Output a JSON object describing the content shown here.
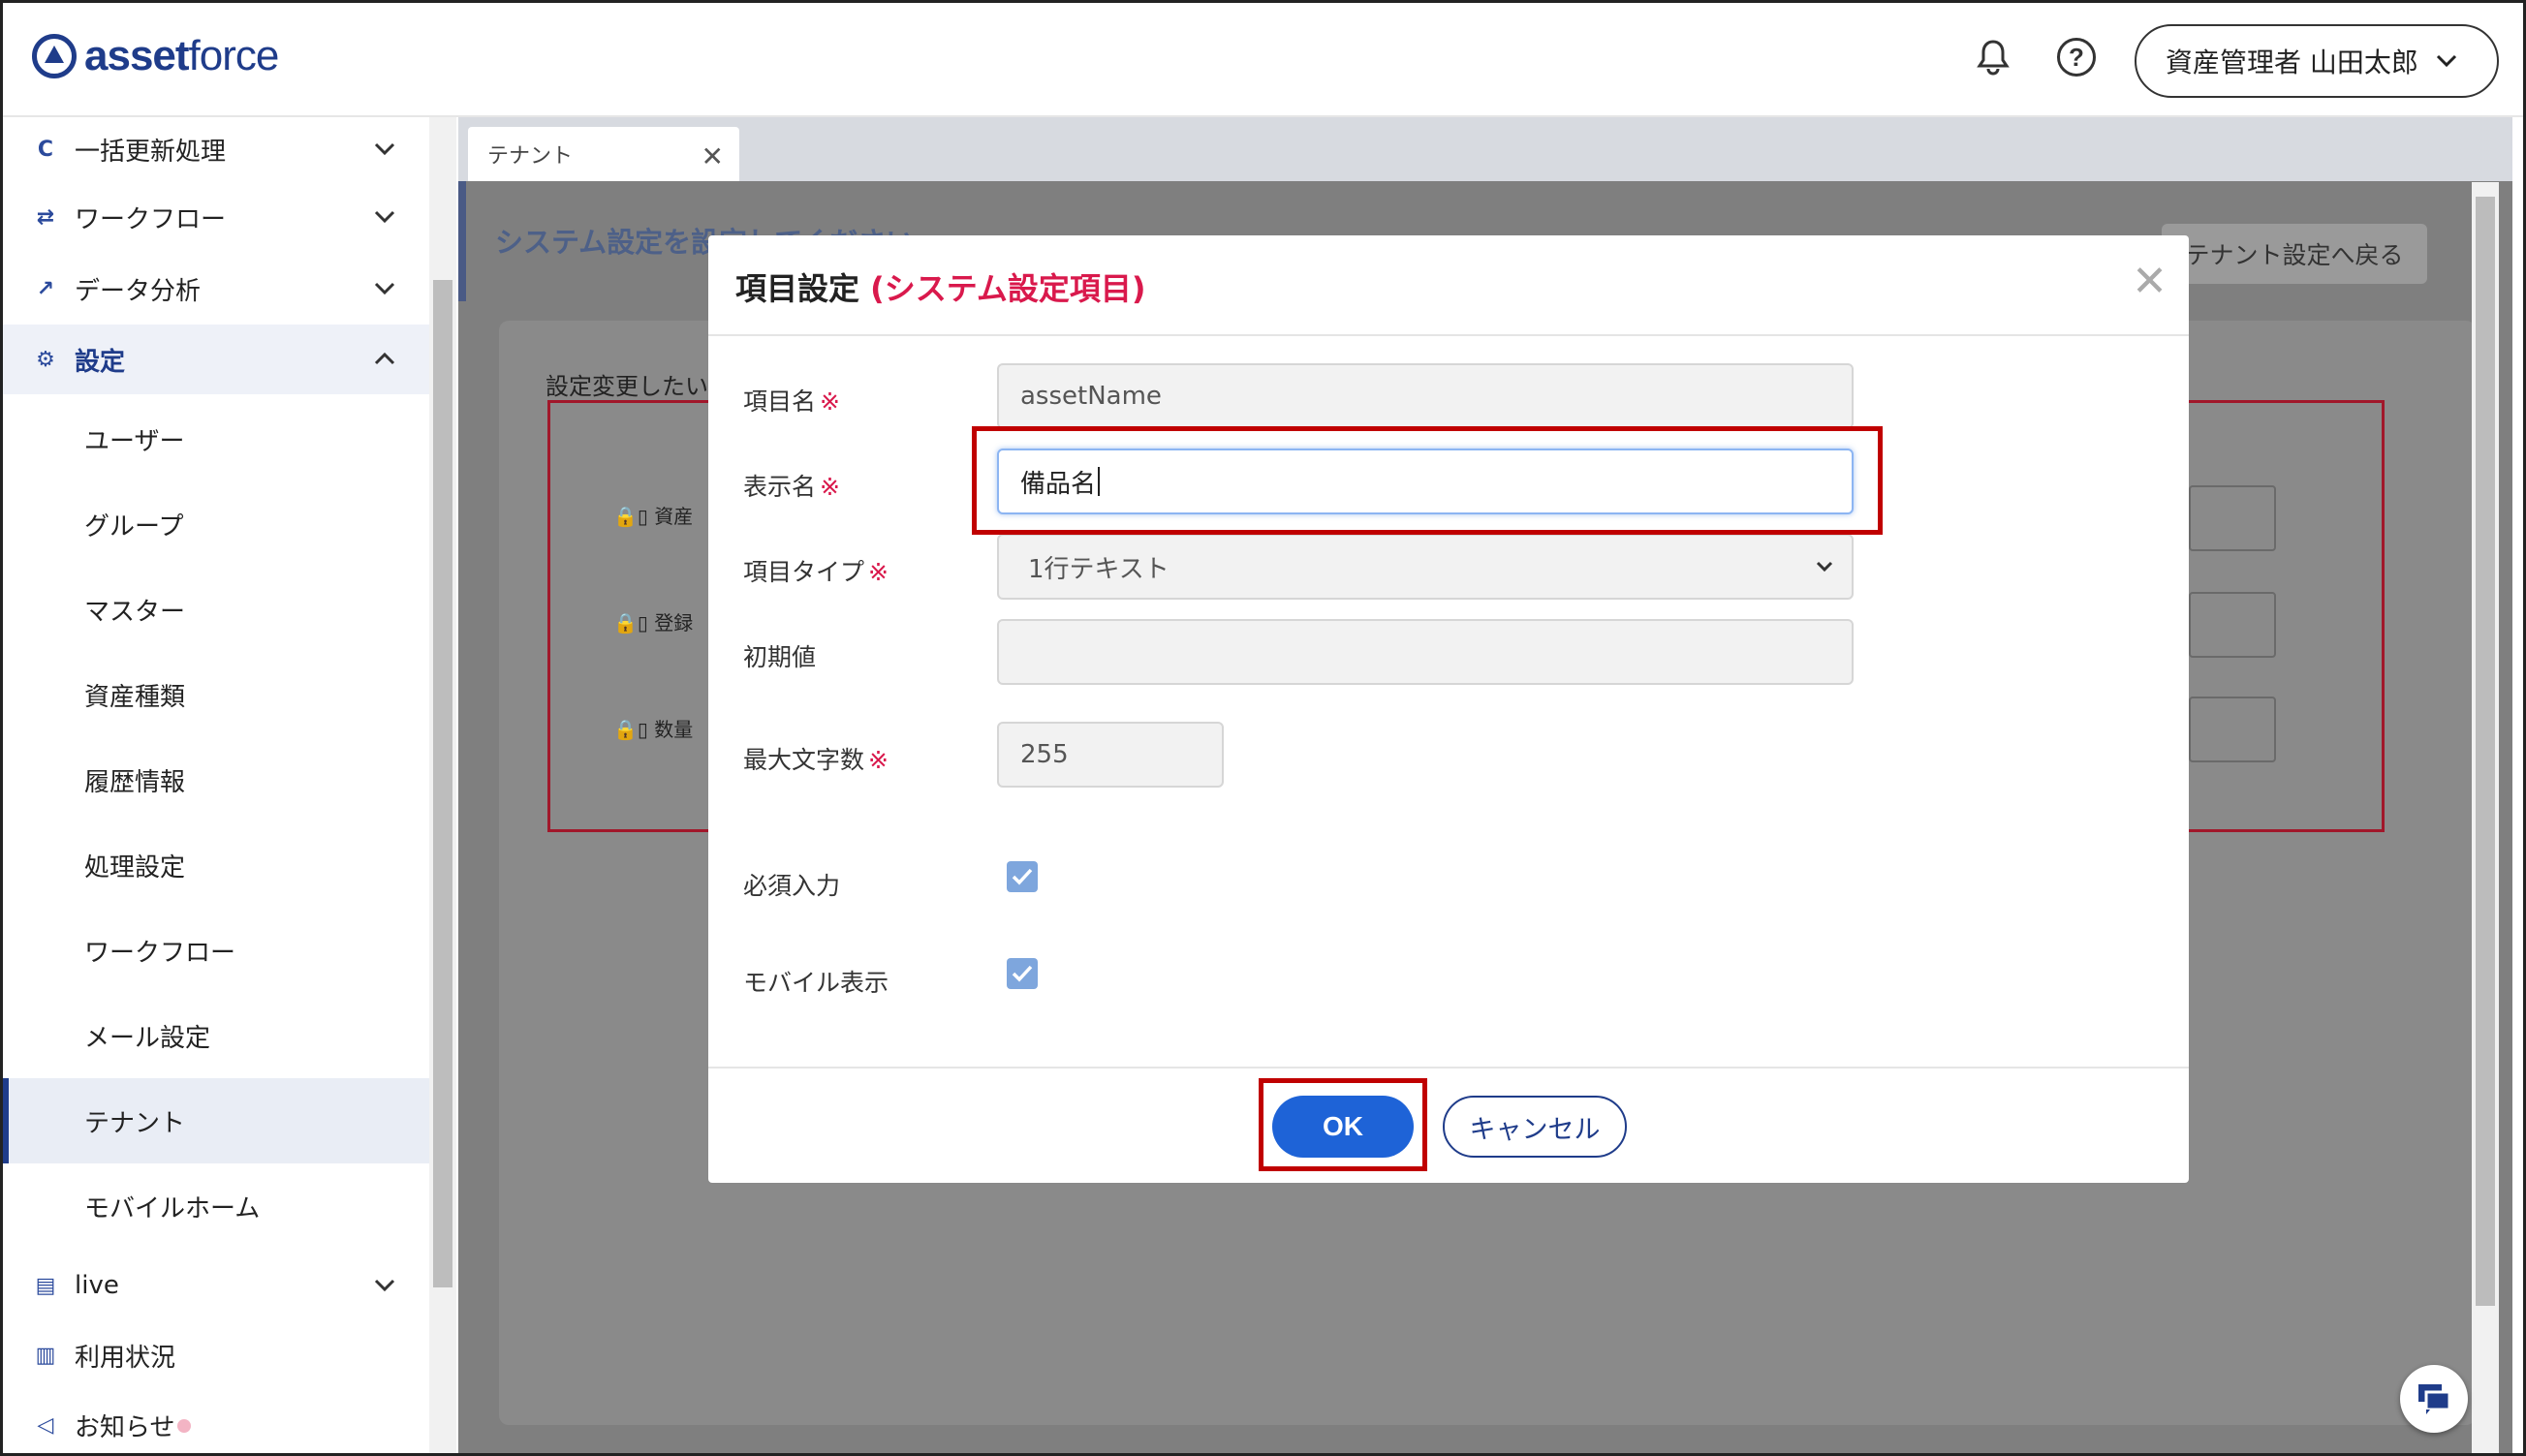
{
  "brand": {
    "bold": "asset",
    "light": "force"
  },
  "header": {
    "user_name": "資産管理者 山田太郎",
    "icons": {
      "notification": "bell-icon",
      "help": "help-circle-icon"
    }
  },
  "sidebar": {
    "groups_top": [
      {
        "label": "一括更新処理",
        "icon": "refresh-icon"
      },
      {
        "label": "ワークフロー",
        "icon": "workflow-icon"
      },
      {
        "label": "データ分析",
        "icon": "analytics-icon"
      }
    ],
    "settings": {
      "label": "設定",
      "icon": "gear-icon"
    },
    "settings_items": [
      "ユーザー",
      "グループ",
      "マスター",
      "資産種類",
      "履歴情報",
      "処理設定",
      "ワークフロー",
      "メール設定",
      "テナント",
      "モバイルホーム"
    ],
    "selected_item": "テナント",
    "groups_bottom": [
      {
        "label": "live",
        "icon": "chat-icon"
      },
      {
        "label": "利用状況",
        "icon": "bar-chart-icon"
      },
      {
        "label": "お知らせ",
        "icon": "megaphone-icon"
      }
    ]
  },
  "main": {
    "tab_label": "テナント",
    "bg_heading": "システム設定を設定してください",
    "bg_back_button": "テナント設定へ戻る",
    "bg_description": "設定変更したい",
    "bg_rows": [
      "資産",
      "登録",
      "数量"
    ]
  },
  "modal": {
    "title": "項目設定",
    "title_sub": "(システム設定項目)",
    "required_mark": "※",
    "fields": {
      "item_name": {
        "label": "項目名",
        "value": "assetName"
      },
      "display_name": {
        "label": "表示名",
        "value": "備品名"
      },
      "item_type": {
        "label": "項目タイプ",
        "value": "1行テキスト"
      },
      "initial_value": {
        "label": "初期値",
        "value": ""
      },
      "max_length": {
        "label": "最大文字数",
        "value": "255"
      },
      "required": {
        "label": "必須入力",
        "checked": true
      },
      "mobile_display": {
        "label": "モバイル表示",
        "checked": true
      }
    },
    "ok_label": "OK",
    "cancel_label": "キャンセル"
  },
  "colors": {
    "brand": "#1f3c8a",
    "accent_red": "#d9194c",
    "ok_blue": "#1e63d7",
    "highlight": "#c00000"
  }
}
